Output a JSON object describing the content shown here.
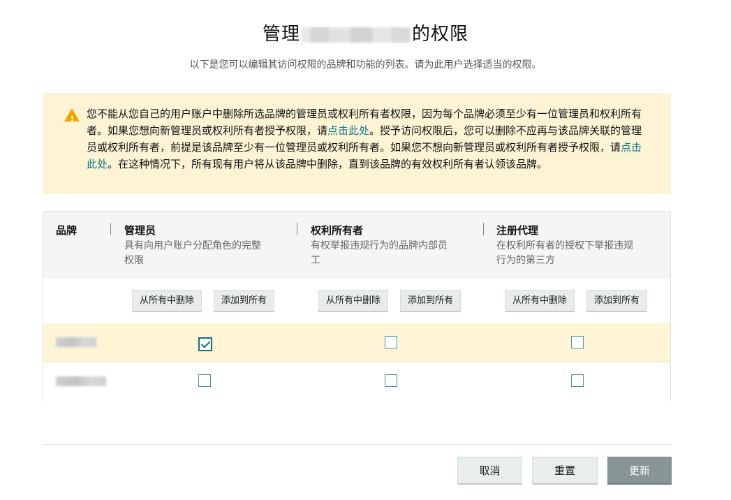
{
  "page": {
    "title_prefix": "管理",
    "title_suffix": "的权限",
    "subtitle": "以下是您可以编辑其访问权限的品牌和功能的列表。请为此用户选择适当的权限。"
  },
  "alert": {
    "icon": "warning-triangle-icon",
    "text_1": "您不能从您自己的用户账户中删除所选品牌的管理员或权利所有者权限，因为每个品牌必须至少有一位管理员和权利所有者。如果您想向新管理员或权利所有者授予权限，请",
    "link_1": "点击此处",
    "text_2": "。授予访问权限后，您可以删除不应再与该品牌关联的管理员或权利所有者，前提是该品牌至少有一位管理员或权利所有者。如果您不想向新管理员或权利所有者授予权限，请",
    "link_2": "点击此处",
    "text_3": "。在这种情况下，所有现有用户将从该品牌中删除，直到该品牌的有效权利所有者认领该品牌。"
  },
  "table": {
    "brand_header": "品牌",
    "columns": [
      {
        "name": "管理员",
        "desc_line1": "具有向用户账户分配角色的完整",
        "desc_line2": "权限",
        "remove_all": "从所有中删除",
        "add_all": "添加到所有"
      },
      {
        "name": "权利所有者",
        "desc_line1": "有权举报违规行为的品牌内部员",
        "desc_line2": "工",
        "remove_all": "从所有中删除",
        "add_all": "添加到所有"
      },
      {
        "name": "注册代理",
        "desc_line1": "在权利所有者的授权下举报违规",
        "desc_line2": "行为的第三方",
        "remove_all": "从所有中删除",
        "add_all": "添加到所有"
      }
    ],
    "rows": [
      {
        "selected": true,
        "checks": [
          true,
          false,
          false
        ]
      },
      {
        "selected": false,
        "checks": [
          false,
          false,
          false
        ]
      }
    ]
  },
  "footer": {
    "cancel": "取消",
    "reset": "重置",
    "update": "更新"
  }
}
